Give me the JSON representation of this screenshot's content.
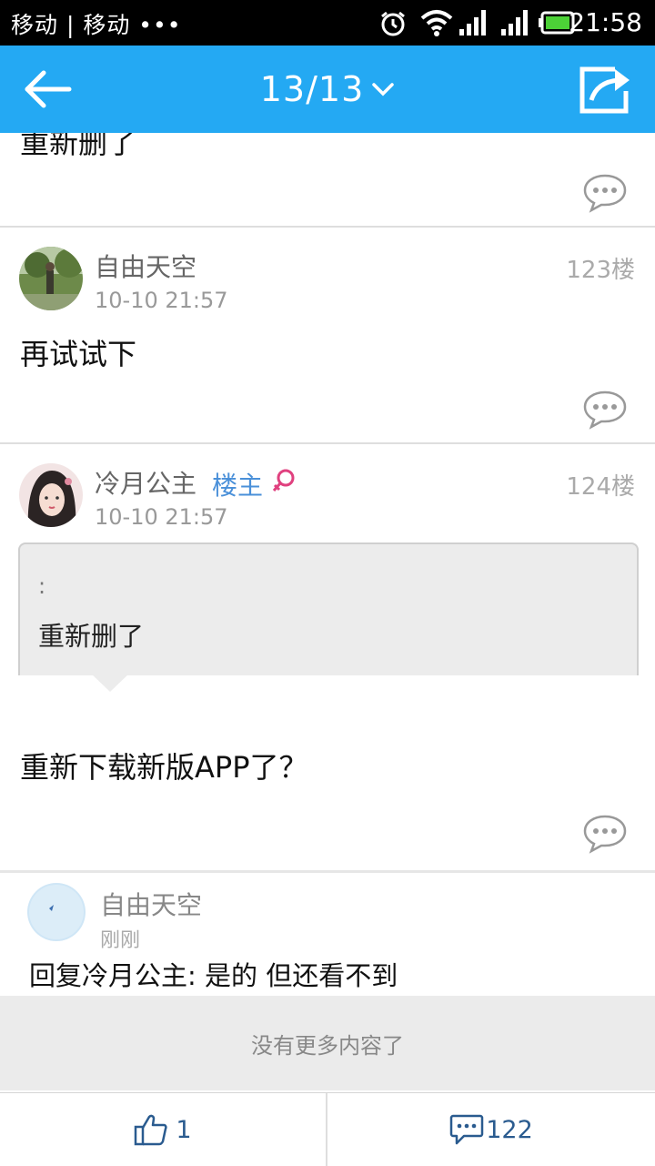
{
  "status_bar": {
    "carrier": "移动 | 移动 •••",
    "time": "21:58"
  },
  "header": {
    "page_indicator": "13/13"
  },
  "posts": [
    {
      "text": "重新删了"
    },
    {
      "author": "自由天空",
      "time": "10-10 21:57",
      "floor": "123楼",
      "text": "再试试下"
    },
    {
      "author": "冷月公主",
      "badge": "楼主",
      "time": "10-10 21:57",
      "floor": "124楼",
      "quote_prefix": ":",
      "quote_text": "重新删了",
      "text": "重新下载新版APP了？"
    }
  ],
  "reply": {
    "author": "自由天空",
    "time": "刚刚",
    "text": "回复冷月公主: 是的 但还看不到"
  },
  "no_more": "没有更多内容了",
  "bottom_bar": {
    "like_count": "1",
    "comment_count": "122"
  },
  "colors": {
    "accent": "#24a9f3",
    "link_blue": "#4a90d9",
    "female_pink": "#e0417f"
  }
}
